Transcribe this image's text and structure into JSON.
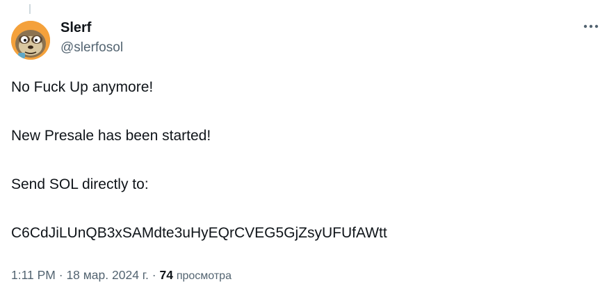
{
  "tweet": {
    "author": {
      "display_name": "Slerf",
      "handle": "@slerfosol",
      "avatar_icon": "cartoon-sloth-avatar"
    },
    "more_icon": "more-horizontal-icon",
    "paragraphs": [
      "No Fuck Up anymore!",
      "New Presale has been started!",
      "Send SOL directly to:",
      "C6CdJiLUnQB3xSAMdte3uHyEQrCVEG5GjZsyUFUfAWtt"
    ],
    "meta": {
      "time": "1:11 PM",
      "separator": "·",
      "date": "18 мар. 2024 г.",
      "views_count": "74",
      "views_label": "просмотра"
    }
  },
  "colors": {
    "text_primary": "#0f1419",
    "text_secondary": "#536471",
    "avatar_orange": "#f4a13b",
    "thread_line": "#cfd9de"
  }
}
